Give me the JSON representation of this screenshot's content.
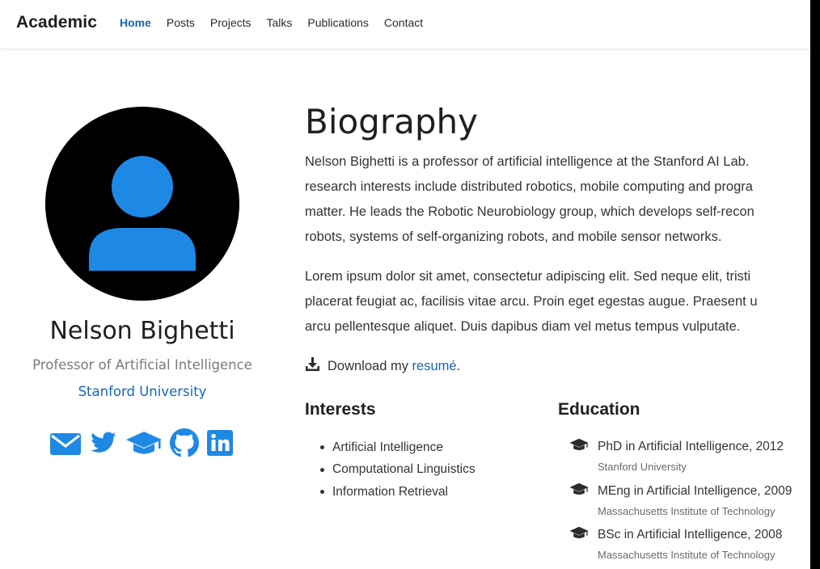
{
  "navbar": {
    "brand": "Academic",
    "links": [
      "Home",
      "Posts",
      "Projects",
      "Talks",
      "Publications",
      "Contact"
    ],
    "active": "Home"
  },
  "profile": {
    "name": "Nelson Bighetti",
    "role": "Professor of Artificial Intelligence",
    "organization": "Stanford University",
    "avatar_icon": "user-icon",
    "social_icons": [
      "envelope-icon",
      "twitter-icon",
      "graduation-cap-icon",
      "github-icon",
      "linkedin-icon"
    ]
  },
  "biography": {
    "title": "Biography",
    "paragraph1_lines": [
      "Nelson Bighetti is a professor of artificial intelligence at the Stanford AI Lab.",
      "research interests include distributed robotics, mobile computing and progra",
      "matter. He leads the Robotic Neurobiology group, which develops self-recon",
      "robots, systems of self-organizing robots, and mobile sensor networks."
    ],
    "paragraph2_lines": [
      "Lorem ipsum dolor sit amet, consectetur adipiscing elit. Sed neque elit, tristi",
      "placerat feugiat ac, facilisis vitae arcu. Proin eget egestas augue. Praesent u",
      "arcu pellentesque aliquet. Duis dapibus diam vel metus tempus vulputate."
    ],
    "download_prefix": "Download my ",
    "download_link": "resumé",
    "download_suffix": "."
  },
  "interests": {
    "title": "Interests",
    "items": [
      "Artificial Intelligence",
      "Computational Linguistics",
      "Information Retrieval"
    ]
  },
  "education": {
    "title": "Education",
    "items": [
      {
        "degree": "PhD in Artificial Intelligence, 2012",
        "institution": "Stanford University"
      },
      {
        "degree": "MEng in Artificial Intelligence, 2009",
        "institution": "Massachusetts Institute of Technology"
      },
      {
        "degree": "BSc in Artificial Intelligence, 2008",
        "institution": "Massachusetts Institute of Technology"
      }
    ]
  },
  "colors": {
    "accent": "#1565c0",
    "icon_blue": "#1e88e5",
    "avatar_bg": "#000000"
  }
}
